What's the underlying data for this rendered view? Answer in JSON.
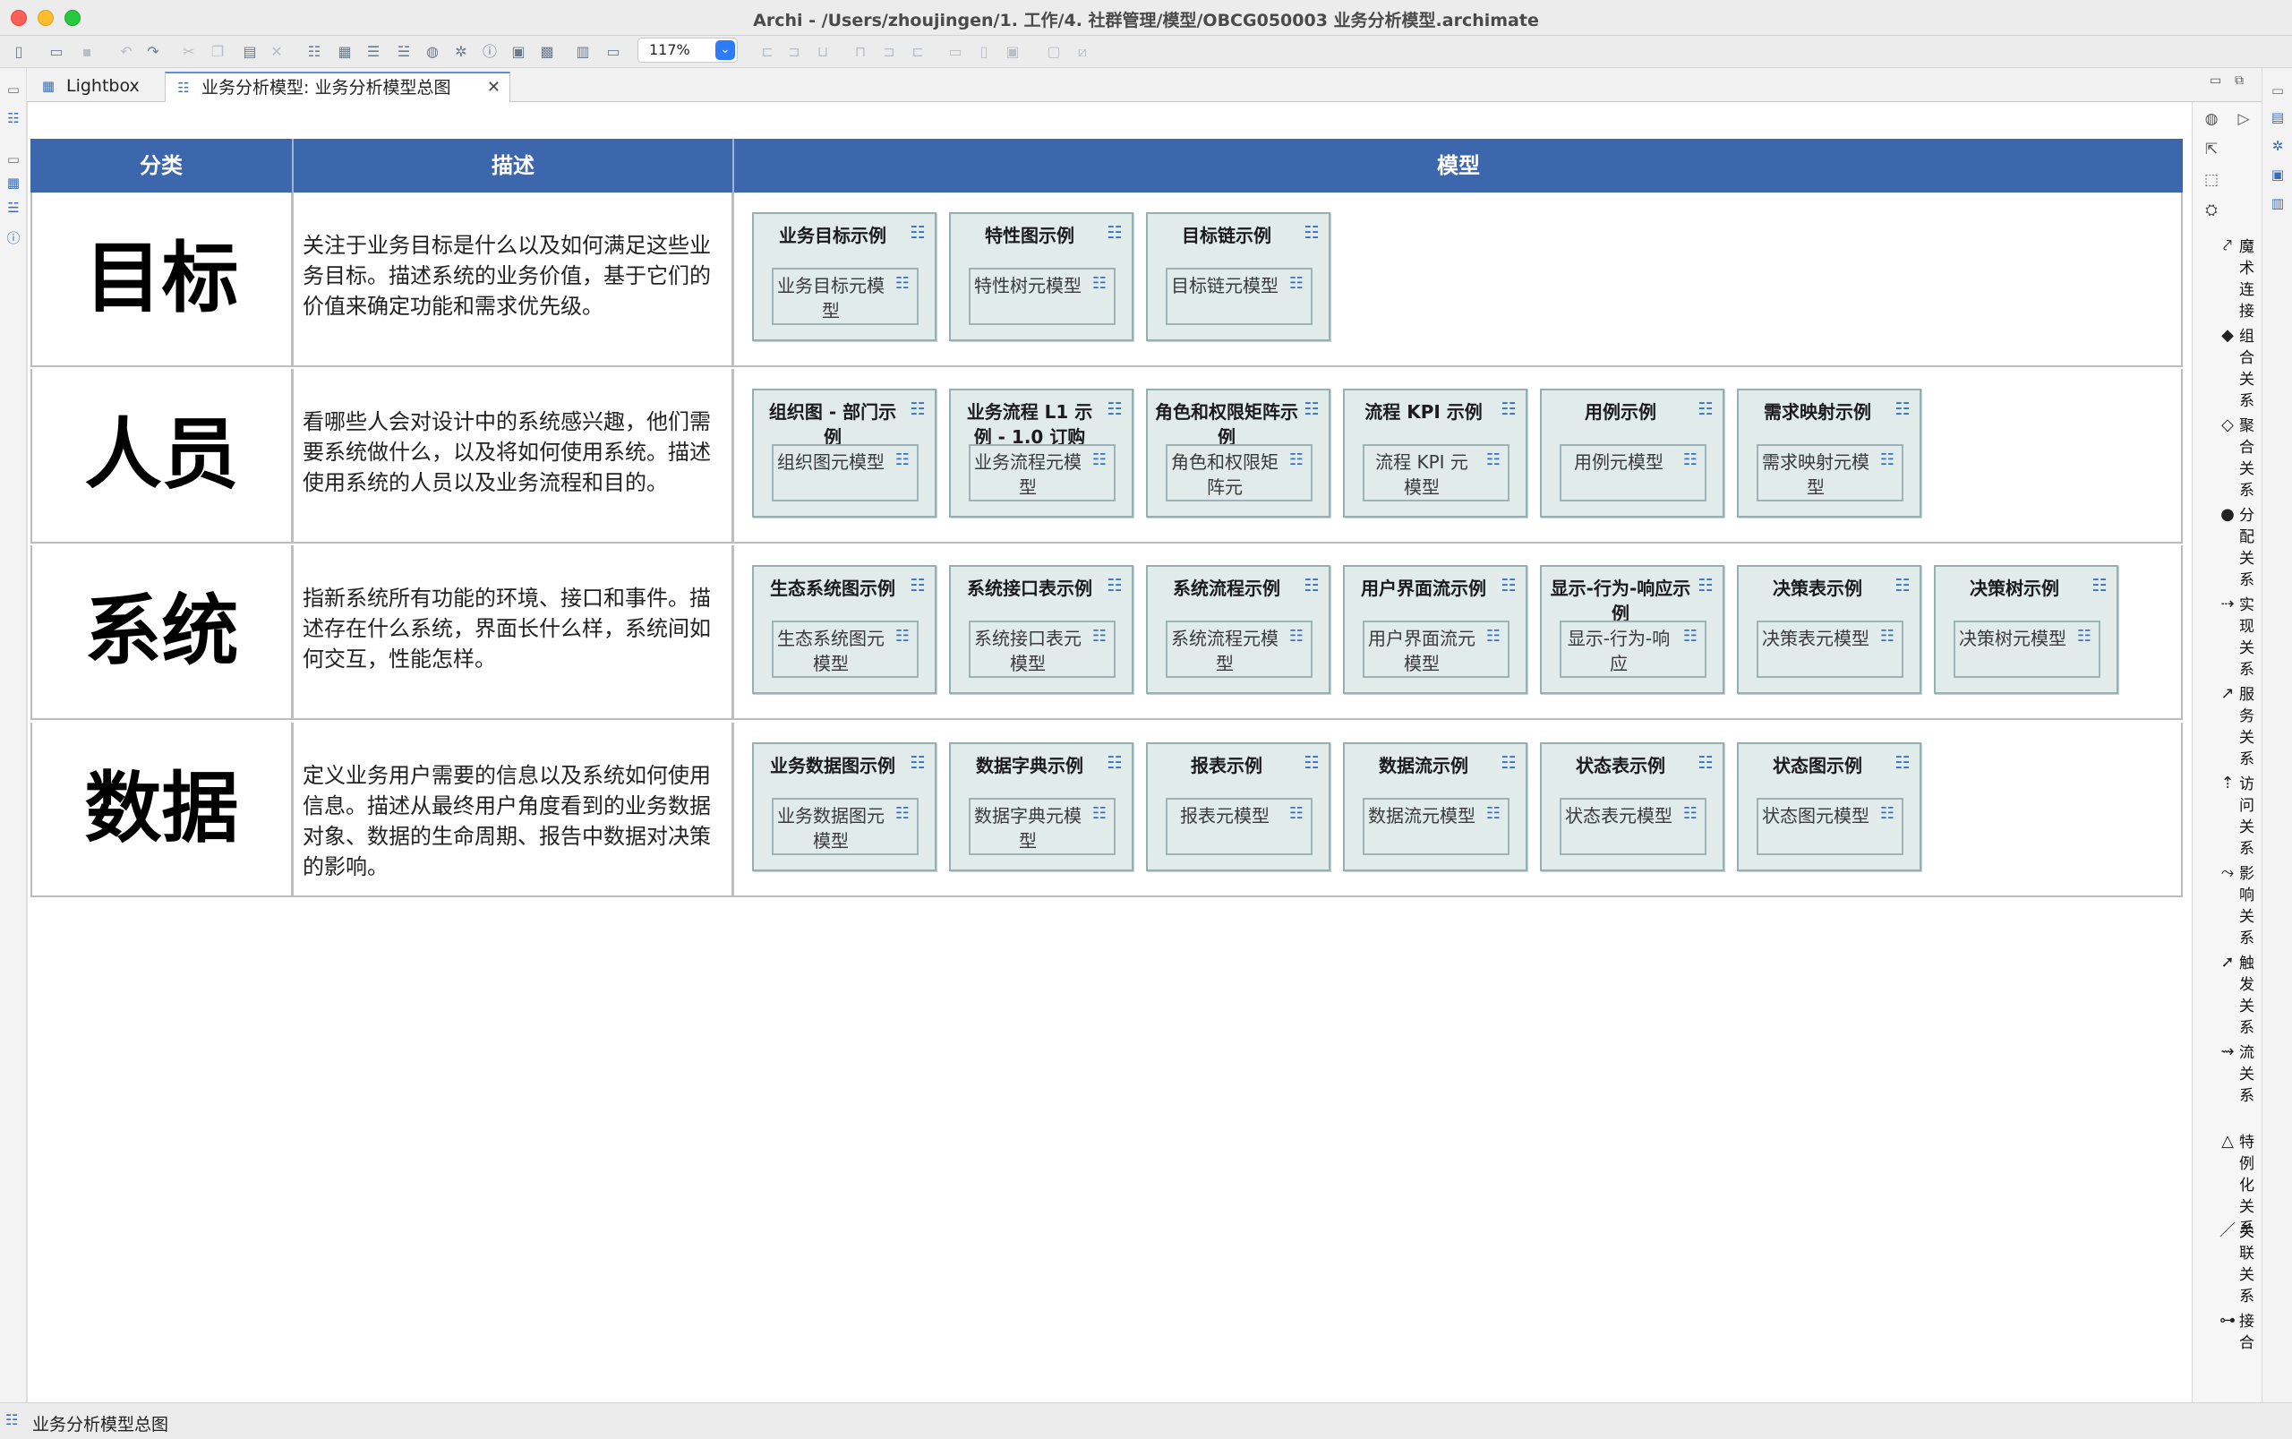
{
  "window": {
    "title": "Archi - /Users/zhoujingen/1. 工作/4. 社群管理/模型/OBCG050003 业务分析模型.archimate"
  },
  "toolbar": {
    "zoom": "117%"
  },
  "tabs": [
    {
      "label": "Lightbox",
      "icon": "lightbox-icon"
    },
    {
      "label": "业务分析模型: 业务分析模型总图",
      "icon": "diagram-icon"
    }
  ],
  "diagram": {
    "headers": [
      "分类",
      "描述",
      "模型"
    ],
    "rows": [
      {
        "category": "目标",
        "description": "关注于业务目标是什么以及如何满足这些业务目标。描述系统的业务价值，基于它们的价值来确定功能和需求优先级。",
        "cards": [
          {
            "title": "业务目标示例",
            "inner": "业务目标元模型"
          },
          {
            "title": "特性图示例",
            "inner": "特性树元模型"
          },
          {
            "title": "目标链示例",
            "inner": "目标链元模型"
          }
        ]
      },
      {
        "category": "人员",
        "description": "看哪些人会对设计中的系统感兴趣，他们需要系统做什么，以及将如何使用系统。描述使用系统的人员以及业务流程和目的。",
        "cards": [
          {
            "title": "组织图 - 部门示例",
            "inner": "组织图元模型"
          },
          {
            "title": "业务流程 L1 示例 - 1.0 订购",
            "inner": "业务流程元模型"
          },
          {
            "title": "角色和权限矩阵示例",
            "inner": "角色和权限矩阵元"
          },
          {
            "title": "流程 KPI 示例",
            "inner": "流程 KPI 元模型"
          },
          {
            "title": "用例示例",
            "inner": "用例元模型"
          },
          {
            "title": "需求映射示例",
            "inner": "需求映射元模型"
          }
        ]
      },
      {
        "category": "系统",
        "description": "指新系统所有功能的环境、接口和事件。描述存在什么系统，界面长什么样，系统间如何交互，性能怎样。",
        "cards": [
          {
            "title": "生态系统图示例",
            "inner": "生态系统图元模型"
          },
          {
            "title": "系统接口表示例",
            "inner": "系统接口表元模型"
          },
          {
            "title": "系统流程示例",
            "inner": "系统流程元模型"
          },
          {
            "title": "用户界面流示例",
            "inner": "用户界面流元模型"
          },
          {
            "title": "显示-行为-响应示例",
            "inner": "显示-行为-响应"
          },
          {
            "title": "决策表示例",
            "inner": "决策表元模型"
          },
          {
            "title": "决策树示例",
            "inner": "决策树元模型"
          }
        ]
      },
      {
        "category": "数据",
        "description": "定义业务用户需要的信息以及系统如何使用信息。描述从最终用户角度看到的业务数据对象、数据的生命周期、报告中数据对决策的影响。",
        "cards": [
          {
            "title": "业务数据图示例",
            "inner": "业务数据图元模型"
          },
          {
            "title": "数据字典示例",
            "inner": "数据字典元模型"
          },
          {
            "title": "报表示例",
            "inner": "报表元模型"
          },
          {
            "title": "数据流示例",
            "inner": "数据流元模型"
          },
          {
            "title": "状态表示例",
            "inner": "状态表元模型"
          },
          {
            "title": "状态图示例",
            "inner": "状态图元模型"
          }
        ]
      }
    ]
  },
  "palette": {
    "relations": [
      {
        "label": "魔术连接",
        "icon": "magic-connector-icon"
      },
      {
        "label": "组合关系",
        "icon": "composition-icon"
      },
      {
        "label": "聚合关系",
        "icon": "aggregation-icon"
      },
      {
        "label": "分配关系",
        "icon": "assignment-icon"
      },
      {
        "label": "实现关系",
        "icon": "realization-icon"
      },
      {
        "label": "服务关系",
        "icon": "serving-icon"
      },
      {
        "label": "访问关系",
        "icon": "access-icon"
      },
      {
        "label": "影响关系",
        "icon": "influence-icon"
      },
      {
        "label": "触发关系",
        "icon": "triggering-icon"
      },
      {
        "label": "流关系",
        "icon": "flow-icon"
      },
      {
        "label": "特例化关系",
        "icon": "specialization-icon"
      },
      {
        "label": "关联关系",
        "icon": "association-icon"
      },
      {
        "label": "接合",
        "icon": "junction-icon"
      }
    ]
  },
  "status": {
    "text": "业务分析模型总图"
  }
}
